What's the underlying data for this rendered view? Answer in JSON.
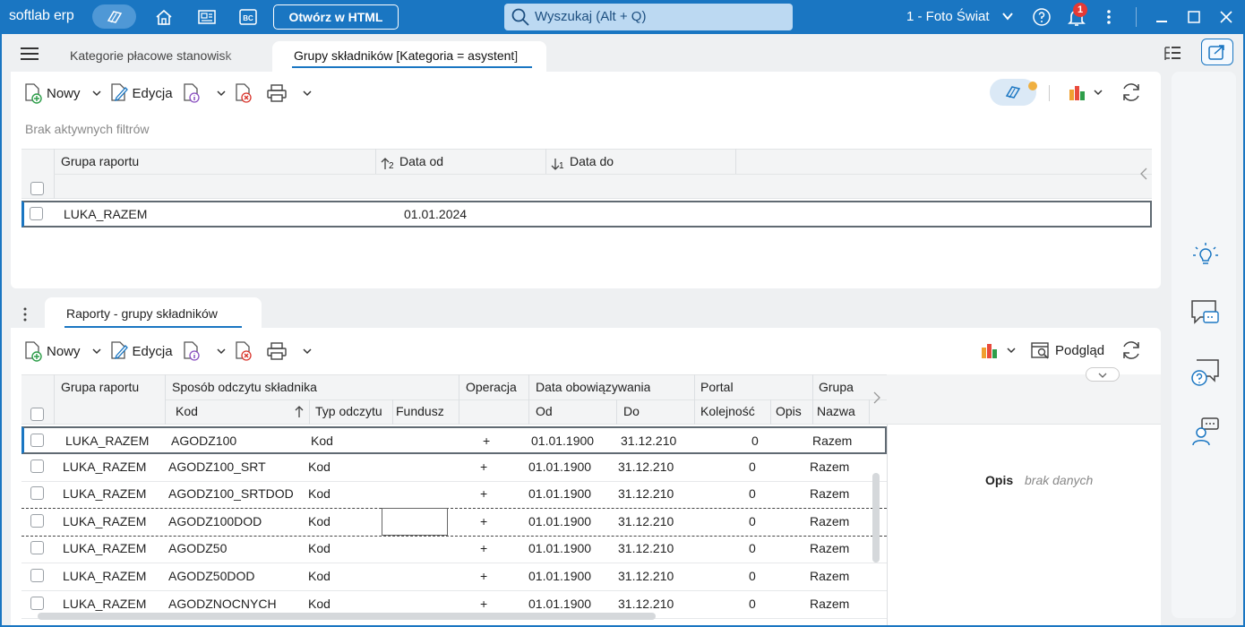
{
  "app": {
    "logo": "softlab erp",
    "html_button": "Otwórz w HTML",
    "search_placeholder": "Wyszukaj (Alt + Q)",
    "company": "1 - Foto Świat",
    "notifications": "1"
  },
  "tabs": [
    {
      "label": "Kategorie płacowe stanowisk"
    },
    {
      "label": "Grupy składników [Kategoria = asystent]"
    }
  ],
  "top": {
    "toolbar": {
      "new": "Nowy",
      "edit": "Edycja"
    },
    "filters": "Brak aktywnych filtrów",
    "columns": [
      "Grupa raportu",
      "Data od",
      "Data do"
    ],
    "sort_markers": [
      "2",
      "1"
    ],
    "rows": [
      {
        "group": "LUKA_RAZEM",
        "from": "01.01.2024",
        "to": ""
      }
    ]
  },
  "bottom": {
    "tab": "Raporty - grupy składników",
    "toolbar": {
      "new": "Nowy",
      "edit": "Edycja",
      "preview": "Podgląd"
    },
    "group_headers": [
      "Grupa raportu",
      "Sposób odczytu składnika",
      "Operacja",
      "Data obowiązywania",
      "Portal",
      "Grupa"
    ],
    "sub_headers": [
      "Kod",
      "Typ odczytu",
      "Fundusz",
      "Od",
      "Do",
      "Kolejność",
      "Opis",
      "Nazwa"
    ],
    "rows": [
      {
        "group": "LUKA_RAZEM",
        "code": "AGODZ100",
        "type": "Kod",
        "fund": "",
        "op": "+",
        "from": "01.01.1900",
        "to": "31.12.210",
        "order": "0",
        "name": "Razem"
      },
      {
        "group": "LUKA_RAZEM",
        "code": "AGODZ100_SRT",
        "type": "Kod",
        "fund": "",
        "op": "+",
        "from": "01.01.1900",
        "to": "31.12.210",
        "order": "0",
        "name": "Razem"
      },
      {
        "group": "LUKA_RAZEM",
        "code": "AGODZ100_SRTDOD",
        "type": "Kod",
        "fund": "",
        "op": "+",
        "from": "01.01.1900",
        "to": "31.12.210",
        "order": "0",
        "name": "Razem"
      },
      {
        "group": "LUKA_RAZEM",
        "code": "AGODZ100DOD",
        "type": "Kod",
        "fund": "",
        "op": "+",
        "from": "01.01.1900",
        "to": "31.12.210",
        "order": "0",
        "name": "Razem"
      },
      {
        "group": "LUKA_RAZEM",
        "code": "AGODZ50",
        "type": "Kod",
        "fund": "",
        "op": "+",
        "from": "01.01.1900",
        "to": "31.12.210",
        "order": "0",
        "name": "Razem"
      },
      {
        "group": "LUKA_RAZEM",
        "code": "AGODZ50DOD",
        "type": "Kod",
        "fund": "",
        "op": "+",
        "from": "01.01.1900",
        "to": "31.12.210",
        "order": "0",
        "name": "Razem"
      },
      {
        "group": "LUKA_RAZEM",
        "code": "AGODZNOCNYCH",
        "type": "Kod",
        "fund": "",
        "op": "+",
        "from": "01.01.1900",
        "to": "31.12.210",
        "order": "0",
        "name": "Razem"
      }
    ],
    "detail": {
      "label": "Opis",
      "value": "brak danych"
    }
  }
}
